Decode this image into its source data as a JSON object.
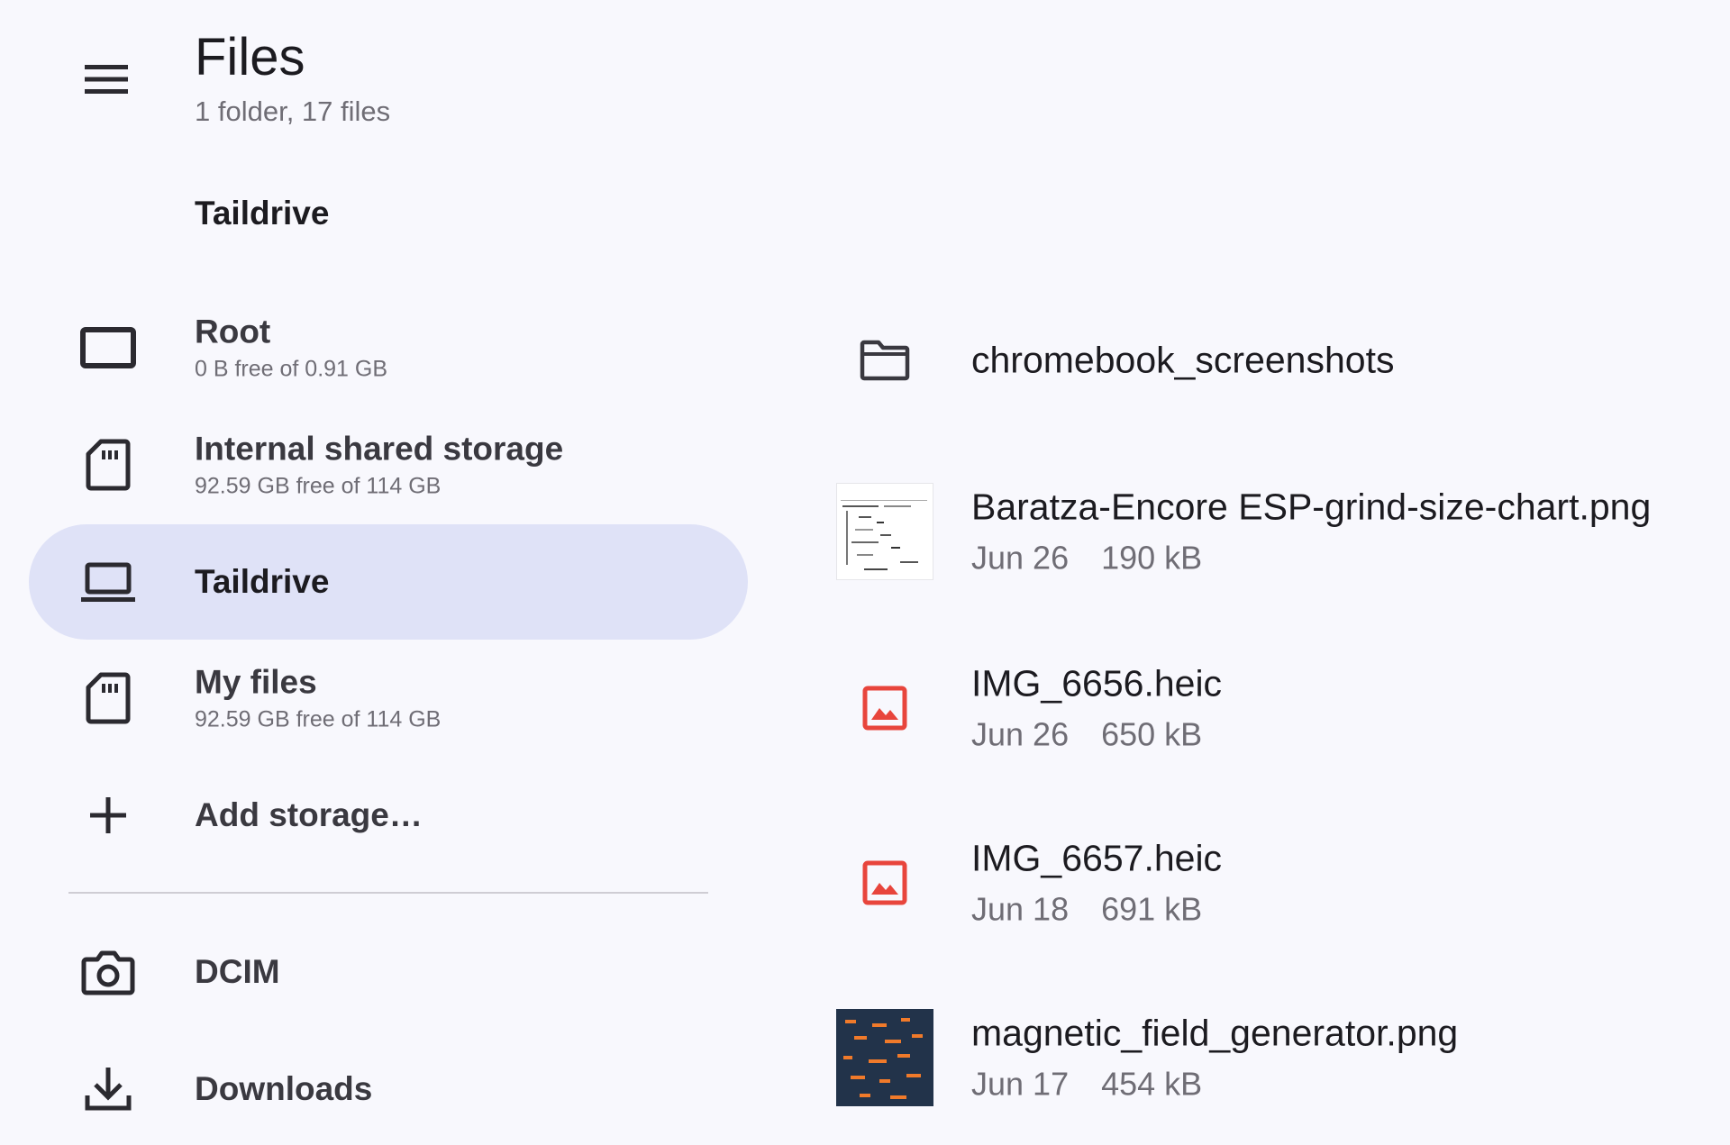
{
  "header": {
    "menu_icon": "hamburger-menu-icon",
    "title": "Files",
    "subtitle": "1 folder, 17 files"
  },
  "sidebar": {
    "section_label": "Taildrive",
    "items": [
      {
        "icon": "root-storage-icon",
        "title": "Root",
        "subtitle": "0 B free of 0.91 GB",
        "active": false
      },
      {
        "icon": "sd-card-icon",
        "title": "Internal shared storage",
        "subtitle": "92.59 GB free of 114 GB",
        "active": false
      },
      {
        "icon": "laptop-icon",
        "title": "Taildrive",
        "subtitle": "",
        "active": true
      },
      {
        "icon": "sd-card-icon",
        "title": "My files",
        "subtitle": "92.59 GB free of 114 GB",
        "active": false
      },
      {
        "icon": "plus-icon",
        "title": "Add storage…",
        "subtitle": "",
        "active": false
      },
      {
        "icon": "camera-icon",
        "title": "DCIM",
        "subtitle": "",
        "active": false
      },
      {
        "icon": "download-icon",
        "title": "Downloads",
        "subtitle": "",
        "active": false
      }
    ]
  },
  "files": [
    {
      "icon": "folder-icon",
      "name": "chromebook_screenshots",
      "date": "",
      "size": ""
    },
    {
      "icon": "image-thumbnail",
      "name": "Baratza-Encore ESP-grind-size-chart.png",
      "date": "Jun 26",
      "size": "190 kB"
    },
    {
      "icon": "image-file-icon",
      "name": "IMG_6656.heic",
      "date": "Jun 26",
      "size": "650 kB"
    },
    {
      "icon": "image-file-icon",
      "name": "IMG_6657.heic",
      "date": "Jun 18",
      "size": "691 kB"
    },
    {
      "icon": "image-thumbnail",
      "name": "magnetic_field_generator.png",
      "date": "Jun 17",
      "size": "454 kB"
    }
  ],
  "colors": {
    "background": "#f8f8fd",
    "active_item": "#dfe2f7",
    "image_icon": "#e8453c",
    "text_secondary": "#6f6d75"
  }
}
